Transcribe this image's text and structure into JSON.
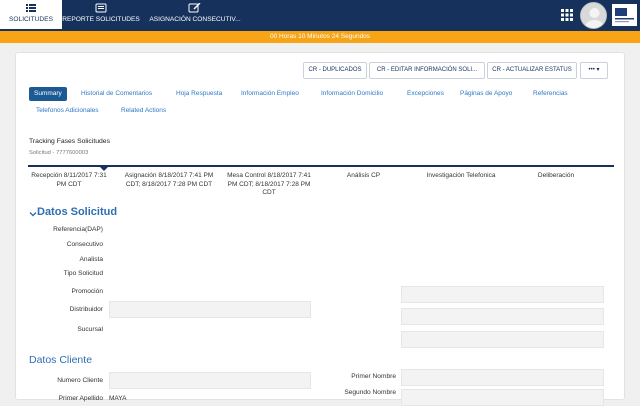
{
  "nav": {
    "tabs": [
      {
        "label": "SOLICITUDES",
        "icon": "list-icon"
      },
      {
        "label": "REPORTE SOLICITUDES",
        "icon": "report-icon"
      },
      {
        "label": "ASIGNACIÓN CONSECUTIV...",
        "icon": "edit-icon"
      }
    ]
  },
  "timer": {
    "text": "00 Horas 10 Minutos 24 Segundos"
  },
  "actions": {
    "duplicados": "CR - DUPLICADOS",
    "editar": "CR - EDITAR INFORMACIÓN SOLI...",
    "actualizar": "CR - ACTUALIZAR ESTATUS",
    "more": "••• ▾"
  },
  "tabs": [
    "Summary",
    "Historial de Comentarios",
    "Hoja Respuesta",
    "Información Empleo",
    "Información Domicilio",
    "Excepciones",
    "Páginas de Apoyo",
    "Referencias",
    "Telefonos Adicionales",
    "Related Actions"
  ],
  "tracking": {
    "title": "Tracking Fases Solicitudes",
    "subtitle": "Solicitud - 7777600003",
    "phases": [
      "Recepción 8/11/2017 7:31 PM CDT",
      "Asignación 8/18/2017 7:41 PM CDT; 8/18/2017 7:28 PM CDT",
      "Mesa Control 8/18/2017 7:41 PM CDT; 8/18/2017 7:28 PM CDT",
      "Análisis CP",
      "Investigación Telefonica",
      "Deliberación"
    ]
  },
  "datos_solicitud": {
    "title": "Datos Solicitud",
    "labels": [
      "Referencia(DAP)",
      "Consecutivo",
      "Analista",
      "Tipo Solicitud",
      "Promoción",
      "Distribuidor",
      "Sucursal"
    ]
  },
  "datos_cliente": {
    "title": "Datos Cliente",
    "numero_cliente": "Numero Cliente",
    "primer_apellido": "Primer Apellido",
    "primer_apellido_value": "MAYA",
    "primer_nombre": "Primer Nombre",
    "segundo_nombre": "Segundo Nombre"
  }
}
